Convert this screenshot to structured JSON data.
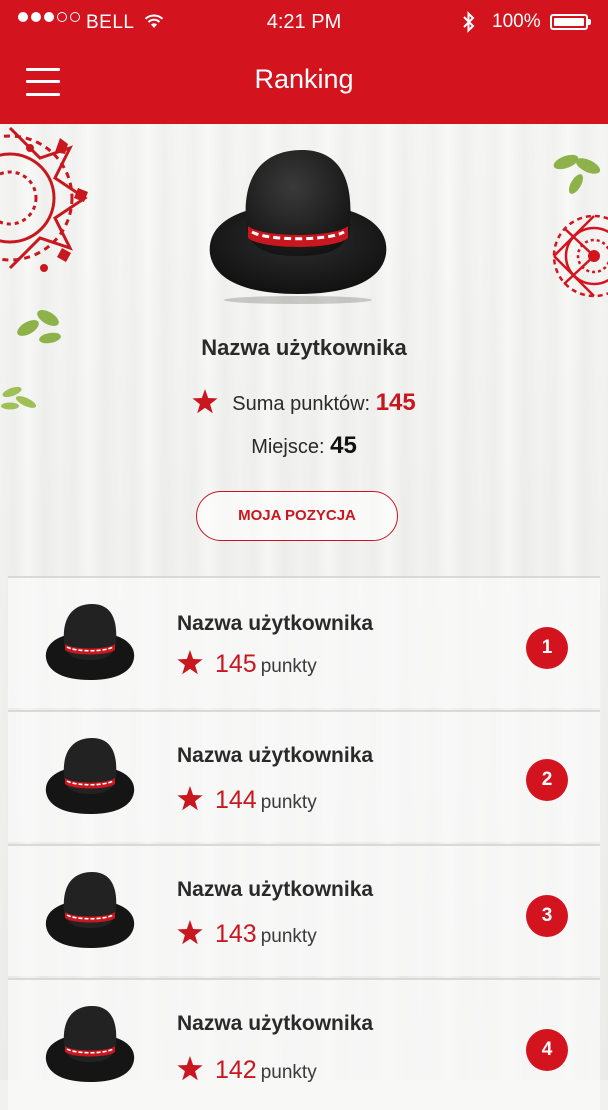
{
  "status_bar": {
    "carrier": "BELL",
    "time": "4:21 PM",
    "battery_percent": "100%",
    "signal_strength": 3,
    "signal_max": 5
  },
  "header": {
    "title": "Ranking",
    "menu_icon": "hamburger-menu-icon"
  },
  "profile": {
    "avatar_icon": "highlander-hat-icon",
    "username": "Nazwa użytkownika",
    "points_label": "Suma punktów:",
    "points_value": "145",
    "place_label": "Miejsce:",
    "place_value": "45",
    "my_position_button": "MOJA POZYCJA"
  },
  "ranking": {
    "items": [
      {
        "username": "Nazwa użytkownika",
        "points": "145",
        "points_unit": "punkty",
        "rank": "1"
      },
      {
        "username": "Nazwa użytkownika",
        "points": "144",
        "points_unit": "punkty",
        "rank": "2"
      },
      {
        "username": "Nazwa użytkownika",
        "points": "143",
        "points_unit": "punkty",
        "rank": "3"
      },
      {
        "username": "Nazwa użytkownika",
        "points": "142",
        "points_unit": "punkty",
        "rank": "4"
      }
    ]
  },
  "colors": {
    "brand_red": "#d3141f",
    "accent_red": "#c8171f",
    "text_dark": "#2a2a2a",
    "leaf_green": "#8db24a"
  }
}
